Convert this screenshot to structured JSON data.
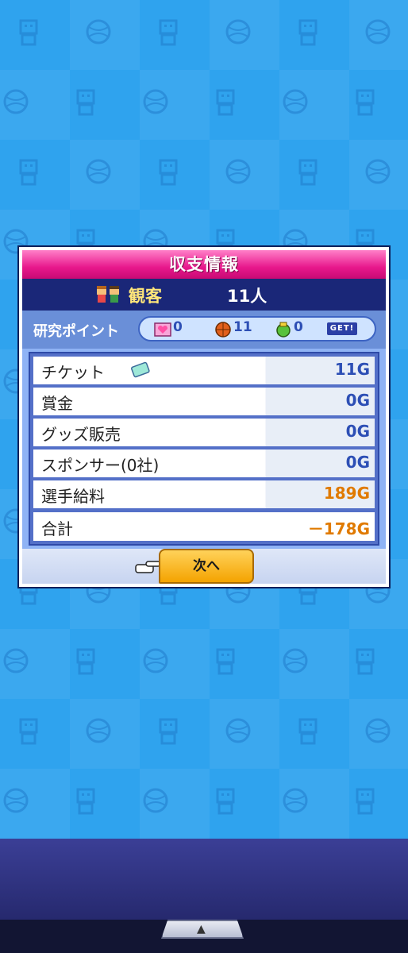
{
  "dialog": {
    "title": "収支情報",
    "audience": {
      "label": "観客",
      "value": "11人"
    },
    "research": {
      "label": "研究ポイント",
      "points": [
        {
          "icon": "heart-icon",
          "value": "0"
        },
        {
          "icon": "basketball-icon",
          "value": "11"
        },
        {
          "icon": "green-ball-icon",
          "value": "0"
        }
      ],
      "get_label": "GET!"
    },
    "rows": [
      {
        "label": "チケット",
        "value": "11G"
      },
      {
        "label": "賞金",
        "value": "0G"
      },
      {
        "label": "グッズ販売",
        "value": "0G"
      },
      {
        "label": "スポンサー(0社)",
        "value": "0G"
      },
      {
        "label": "選手給料",
        "value": "189G"
      }
    ],
    "total": {
      "label": "合計",
      "value": "－178G"
    },
    "next_button": "次へ"
  },
  "colors": {
    "title_bar": "#e8188c",
    "audience_bar": "#1a2778",
    "value_blue": "#2d4fb5",
    "value_orange": "#e07a00",
    "button": "#f4a300",
    "background": "#2fa3ee"
  }
}
